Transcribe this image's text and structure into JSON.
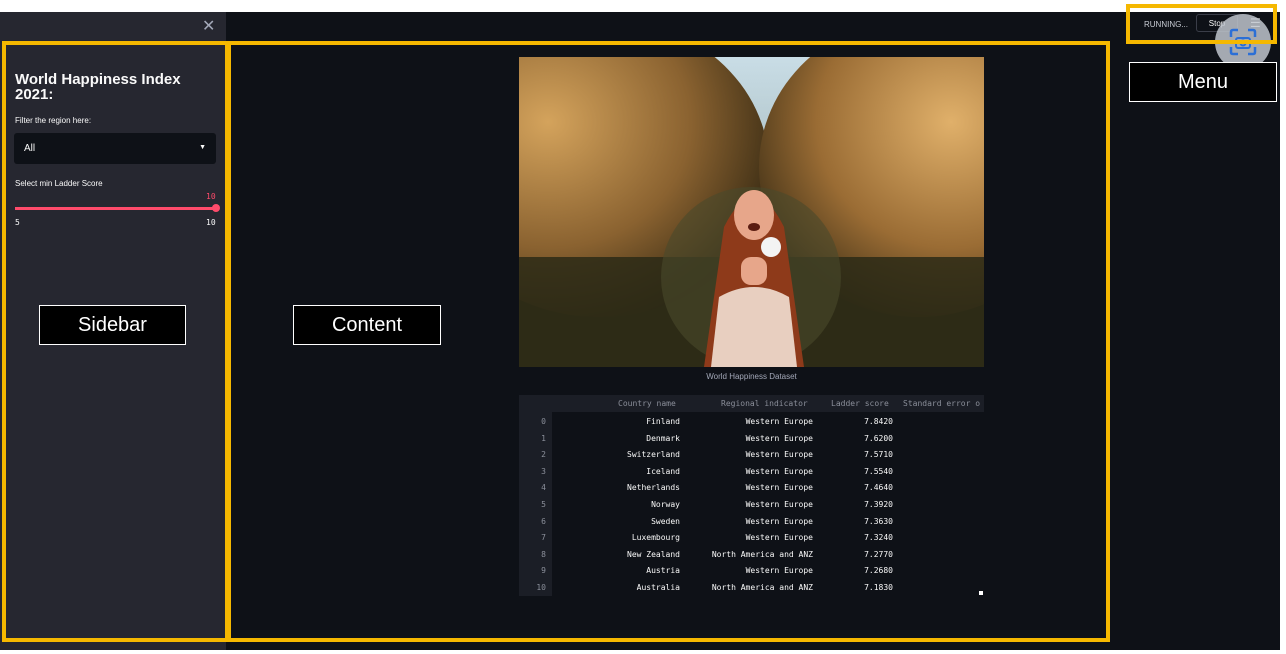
{
  "sidebar": {
    "title": "World Happiness Index 2021:",
    "filter_label": "Filter the region here:",
    "region_select": {
      "value": "All"
    },
    "slider_label": "Select min Ladder Score",
    "slider": {
      "value": "10",
      "min_label": "5",
      "max_label": "10",
      "fill_fraction": 1.0
    }
  },
  "toolbar": {
    "status": "RUNNING...",
    "stop_label": "Stop"
  },
  "annotations": {
    "sidebar": "Sidebar",
    "content": "Content",
    "menu": "Menu"
  },
  "main": {
    "image_caption": "World Happiness Dataset",
    "table": {
      "columns": [
        "Country name",
        "Regional indicator",
        "Ladder score",
        "Standard error o"
      ],
      "rows": [
        {
          "index": "0",
          "country": "Finland",
          "region": "Western Europe",
          "score": "7.8420"
        },
        {
          "index": "1",
          "country": "Denmark",
          "region": "Western Europe",
          "score": "7.6200"
        },
        {
          "index": "2",
          "country": "Switzerland",
          "region": "Western Europe",
          "score": "7.5710"
        },
        {
          "index": "3",
          "country": "Iceland",
          "region": "Western Europe",
          "score": "7.5540"
        },
        {
          "index": "4",
          "country": "Netherlands",
          "region": "Western Europe",
          "score": "7.4640"
        },
        {
          "index": "5",
          "country": "Norway",
          "region": "Western Europe",
          "score": "7.3920"
        },
        {
          "index": "6",
          "country": "Sweden",
          "region": "Western Europe",
          "score": "7.3630"
        },
        {
          "index": "7",
          "country": "Luxembourg",
          "region": "Western Europe",
          "score": "7.3240"
        },
        {
          "index": "8",
          "country": "New Zealand",
          "region": "North America and ANZ",
          "score": "7.2770"
        },
        {
          "index": "9",
          "country": "Austria",
          "region": "Western Europe",
          "score": "7.2680"
        },
        {
          "index": "10",
          "country": "Australia",
          "region": "North America and ANZ",
          "score": "7.1830"
        }
      ]
    }
  },
  "colors": {
    "accent": "#ff4b6b",
    "highlight_box": "#f5b800",
    "app_bg": "#0e1117",
    "sidebar_bg": "#262730"
  },
  "icons": [
    "close-icon",
    "caret-down-icon",
    "hamburger-menu-icon",
    "screenshot-camera-icon"
  ]
}
